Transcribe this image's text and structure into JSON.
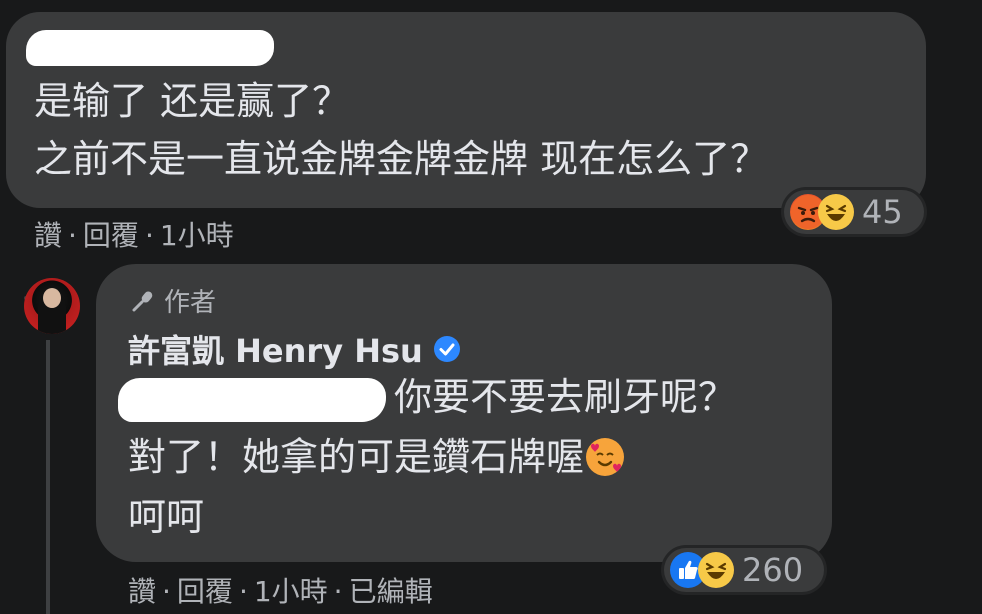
{
  "comment1": {
    "line1": "是输了 还是赢了？",
    "line2": "之前不是一直说金牌金牌金牌 现在怎么了？",
    "reactions": {
      "icons": [
        "angry-icon",
        "haha-icon"
      ],
      "count": "45"
    },
    "meta": {
      "like": "讚",
      "reply": "回覆",
      "time": "1小時"
    }
  },
  "comment2": {
    "author_tag": "作者",
    "author_name": "許富凱 Henry Hsu",
    "line1": "你要不要去刷牙呢？",
    "line2": "對了！她拿的可是鑽石牌喔",
    "line3": "呵呵",
    "reactions": {
      "icons": [
        "like-icon",
        "haha-icon"
      ],
      "count": "260"
    },
    "meta": {
      "like": "讚",
      "reply": "回覆",
      "time": "1小時",
      "edited": "已編輯"
    }
  },
  "meta_separator": "·",
  "colors": {
    "background": "#18191a",
    "bubble": "#3a3b3c",
    "text": "#e4e6eb",
    "secondary_text": "#b0b3b8",
    "verified_badge": "#2d88ff"
  }
}
